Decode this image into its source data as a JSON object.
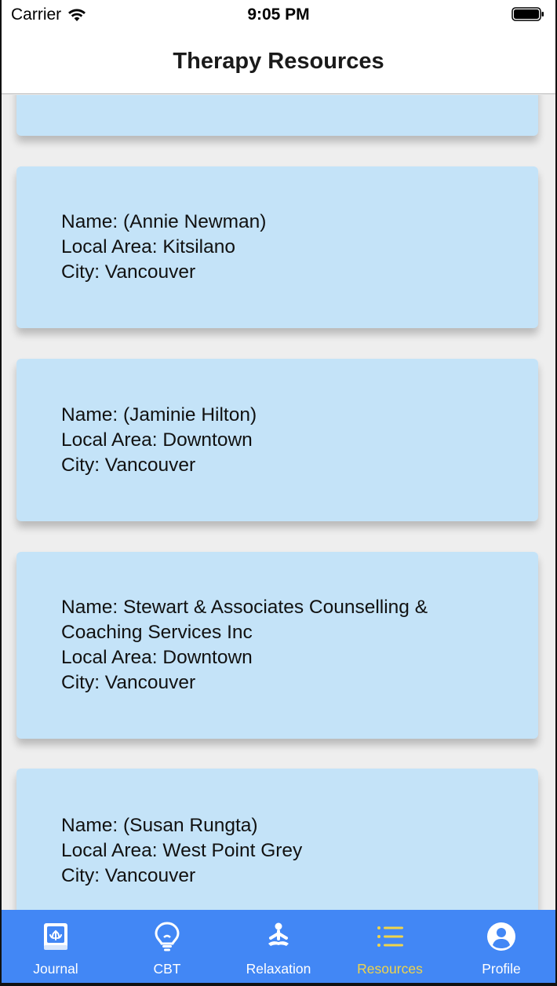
{
  "status_bar": {
    "carrier": "Carrier",
    "time": "9:05 PM"
  },
  "nav": {
    "title": "Therapy Resources"
  },
  "resources": [
    {
      "lines": []
    },
    {
      "lines": [
        "Name: (Annie Newman)",
        "Local Area: Kitsilano",
        "City: Vancouver"
      ]
    },
    {
      "lines": [
        "Name: (Jaminie Hilton)",
        "Local Area: Downtown",
        "City: Vancouver"
      ]
    },
    {
      "lines": [
        "Name: Stewart & Associates Counselling & Coaching Services Inc",
        "Local Area: Downtown",
        "City: Vancouver"
      ]
    },
    {
      "lines": [
        "Name: (Susan Rungta)",
        "Local Area: West Point Grey",
        "City: Vancouver"
      ]
    }
  ],
  "tabs": [
    {
      "label": "Journal",
      "icon": "journal-icon",
      "active": false
    },
    {
      "label": "CBT",
      "icon": "lightbulb-icon",
      "active": false
    },
    {
      "label": "Relaxation",
      "icon": "meditation-icon",
      "active": false
    },
    {
      "label": "Resources",
      "icon": "list-icon",
      "active": true
    },
    {
      "label": "Profile",
      "icon": "profile-icon",
      "active": false
    }
  ],
  "colors": {
    "card_background": "#c4e3f8",
    "tab_bar": "#4287f5",
    "tab_active": "#f0d44a",
    "tab_inactive": "#ffffff"
  }
}
